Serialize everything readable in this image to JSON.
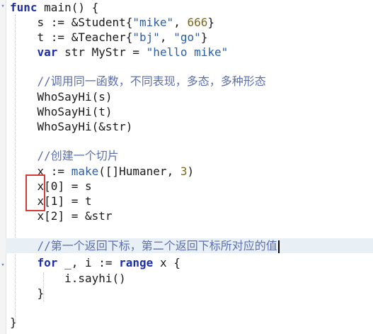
{
  "code": {
    "line_func": "func",
    "line_func_rest": " main() {",
    "line_student_pre": "    s := &Student{",
    "line_student_str": "\"mike\"",
    "line_student_mid": ", ",
    "line_student_num": "666",
    "line_student_post": "}",
    "line_teacher_pre": "    t := &Teacher{",
    "line_teacher_str1": "\"bj\"",
    "line_teacher_mid": ", ",
    "line_teacher_str2": "\"go\"",
    "line_teacher_post": "}",
    "line_var_indent": "    ",
    "line_var_kw": "var",
    "line_var_mid": " str MyStr = ",
    "line_var_str": "\"hello mike\"",
    "comment_1": "    //调用同一函数，不同表现，多态，多种形态",
    "call_1": "    WhoSayHi(s)",
    "call_2": "    WhoSayHi(t)",
    "call_3": "    WhoSayHi(&str)",
    "comment_2": "    //创建一个切片",
    "make_pre": "    x := ",
    "make_kw": "make",
    "make_mid": "([]Humaner, ",
    "make_num": "3",
    "make_post": ")",
    "assign_0_pre": "    x[",
    "assign_0_idx": "0",
    "assign_0_post": "] = s",
    "assign_1_pre": "    x[",
    "assign_1_idx": "1",
    "assign_1_post": "] = t",
    "assign_2_pre": "    x[",
    "assign_2_idx": "2",
    "assign_2_post": "] = &str",
    "comment_3": "    //第一个返回下标，第二个返回下标所对应的值",
    "for_indent": "    ",
    "for_kw": "for",
    "for_mid": " _, i := ",
    "for_range": "range",
    "for_post": " x {",
    "sayhi": "        i.sayhi()",
    "close_inner": "    }",
    "close_outer": "}"
  },
  "colors": {
    "keyword": "#1d2fa8",
    "string": "#2a5fa6",
    "number": "#7a6a1e",
    "comment": "#5b6fb0",
    "current_line": "#e8f0f6",
    "annotation": "#d63a34"
  }
}
